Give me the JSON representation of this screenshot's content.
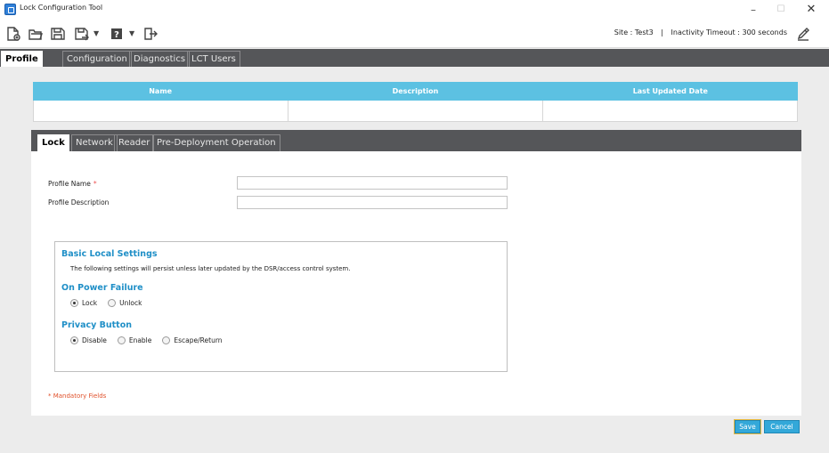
{
  "window": {
    "title": "Lock Configuration Tool",
    "minimize": "–",
    "maximize": "☐",
    "close": "✕"
  },
  "toolbar": {
    "site_label": "Site :",
    "site_value": "Test3",
    "separator": "|",
    "timeout_label": "Inactivity Timeout :",
    "timeout_value": "300 seconds",
    "icons": [
      "new-file-icon",
      "open-folder-icon",
      "save-icon",
      "save-as-icon",
      "help-icon",
      "exit-icon",
      "edit-icon"
    ]
  },
  "main_tabs": [
    {
      "label": "Profile",
      "active": true
    },
    {
      "label": "Configuration",
      "active": false
    },
    {
      "label": "Diagnostics",
      "active": false
    },
    {
      "label": "LCT Users",
      "active": false
    }
  ],
  "profile_grid": {
    "columns": [
      "Name",
      "Description",
      "Last Updated Date"
    ],
    "rows": [
      [
        "",
        "",
        ""
      ]
    ]
  },
  "sub_tabs": [
    {
      "label": "Lock",
      "active": true
    },
    {
      "label": "Network",
      "active": false
    },
    {
      "label": "Reader",
      "active": false
    },
    {
      "label": "Pre-Deployment Operation",
      "active": false
    }
  ],
  "lock_form": {
    "profile_name_label": "Profile Name",
    "required_marker": "*",
    "profile_name_value": "",
    "profile_description_label": "Profile Description",
    "profile_description_value": "",
    "basic_title": "Basic Local Settings",
    "basic_note": "The following settings will persist unless later updated by the DSR/access control system.",
    "power_failure_title": "On Power Failure",
    "power_failure_options": [
      {
        "label": "Lock",
        "checked": true
      },
      {
        "label": "Unlock",
        "checked": false
      }
    ],
    "privacy_title": "Privacy Button",
    "privacy_options": [
      {
        "label": "Disable",
        "checked": true
      },
      {
        "label": "Enable",
        "checked": false
      },
      {
        "label": "Escape/Return",
        "checked": false
      }
    ],
    "mandatory_note": "* Mandatory Fields"
  },
  "buttons": {
    "save": "Save",
    "cancel": "Cancel"
  },
  "colors": {
    "grid_header": "#5cc1e2",
    "tab_strip": "#555659",
    "section_title": "#1f8fc7",
    "button": "#33a8d9",
    "mandatory": "#e0502a"
  }
}
